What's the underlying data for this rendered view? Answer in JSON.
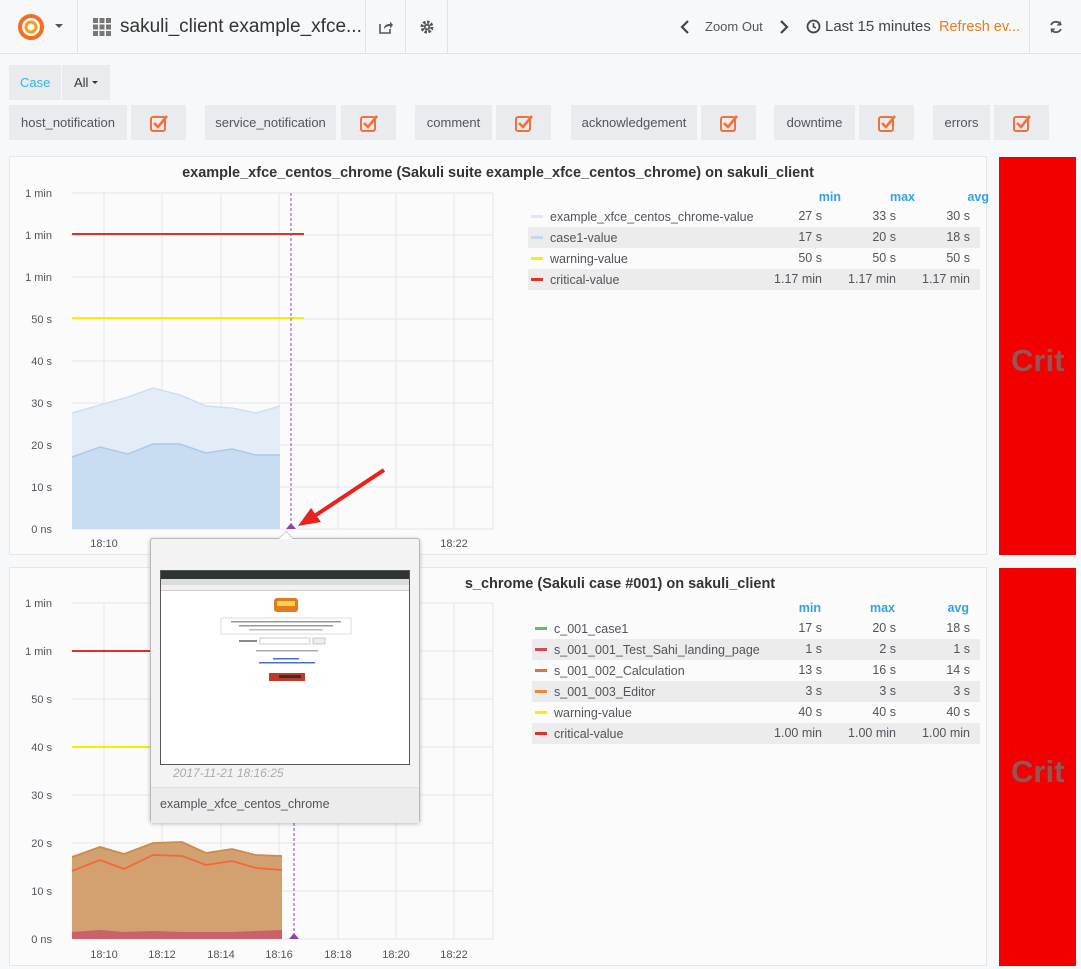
{
  "navbar": {
    "dashboard_title": "sakuli_client example_xfce...",
    "zoom_out": "Zoom Out",
    "time_range": "Last 15 minutes",
    "refresh": "Refresh ev..."
  },
  "variables": {
    "case_label": "Case",
    "case_value": "All"
  },
  "annotations": [
    {
      "label": "host_notification",
      "checked": true
    },
    {
      "label": "service_notification",
      "checked": true
    },
    {
      "label": "comment",
      "checked": true
    },
    {
      "label": "acknowledgement",
      "checked": true
    },
    {
      "label": "downtime",
      "checked": true
    },
    {
      "label": "errors",
      "checked": true
    }
  ],
  "panel1": {
    "title": "example_xfce_centos_chrome (Sakuli suite example_xfce_centos_chrome) on sakuli_client",
    "y_ticks": [
      "1 min",
      "1 min",
      "1 min",
      "50 s",
      "40 s",
      "30 s",
      "20 s",
      "10 s",
      "0 ns"
    ],
    "x_ticks": [
      "18:10",
      "18:22"
    ],
    "legend_headers": {
      "min": "min",
      "max": "max",
      "avg": "avg"
    },
    "legend": [
      {
        "name": "example_xfce_centos_chrome-value",
        "min": "27 s",
        "max": "33 s",
        "avg": "30 s",
        "color": "#dce9f5"
      },
      {
        "name": "case1-value",
        "min": "17 s",
        "max": "20 s",
        "avg": "18 s",
        "color": "#c3d9ef"
      },
      {
        "name": "warning-value",
        "min": "50 s",
        "max": "50 s",
        "avg": "50 s",
        "color": "#f2f200"
      },
      {
        "name": "critical-value",
        "min": "1.17 min",
        "max": "1.17 min",
        "avg": "1.17 min",
        "color": "#e0302a"
      }
    ],
    "status": "Crit"
  },
  "panel2": {
    "title": "s_chrome (Sakuli case #001) on sakuli_client",
    "y_ticks": [
      "1 min",
      "1 min",
      "50 s",
      "40 s",
      "30 s",
      "20 s",
      "10 s",
      "0 ns"
    ],
    "x_ticks": [
      "18:10",
      "18:12",
      "18:14",
      "18:16",
      "18:18",
      "18:20",
      "18:22"
    ],
    "legend_headers": {
      "min": "min",
      "max": "max",
      "avg": "avg"
    },
    "legend": [
      {
        "name": "c_001_case1",
        "min": "17 s",
        "max": "20 s",
        "avg": "18 s",
        "color": "#6db46d"
      },
      {
        "name": "s_001_001_Test_Sahi_landing_page",
        "min": "1 s",
        "max": "2 s",
        "avg": "1 s",
        "color": "#d4485a"
      },
      {
        "name": "s_001_002_Calculation",
        "min": "13 s",
        "max": "16 s",
        "avg": "14 s",
        "color": "#ee6a3a"
      },
      {
        "name": "s_001_003_Editor",
        "min": "3 s",
        "max": "3 s",
        "avg": "3 s",
        "color": "#e8873a"
      },
      {
        "name": "warning-value",
        "min": "40 s",
        "max": "40 s",
        "avg": "40 s",
        "color": "#f2f200"
      },
      {
        "name": "critical-value",
        "min": "1.00 min",
        "max": "1.00 min",
        "avg": "1.00 min",
        "color": "#e0302a"
      }
    ],
    "status": "Crit"
  },
  "tooltip": {
    "time": "2017-11-21 18:16:25",
    "name": "example_xfce_centos_chrome"
  },
  "colors": {
    "accent_blue": "#33b5e5",
    "refresh_orange": "#eb7b18",
    "critical_red": "#f20000",
    "checkbox_orange": "#f0713a"
  }
}
